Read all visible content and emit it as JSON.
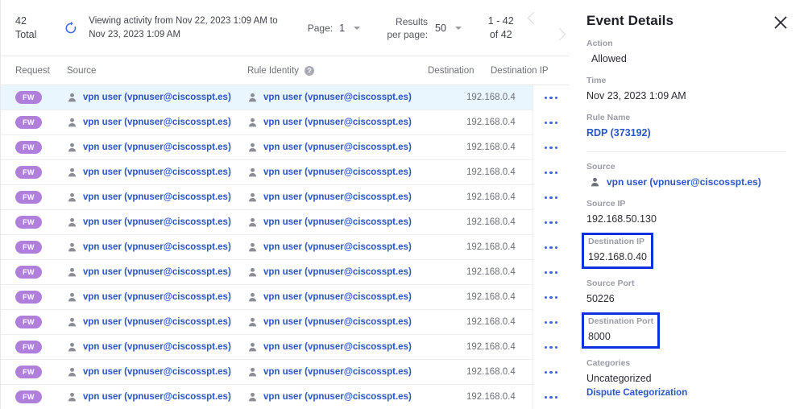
{
  "toolbar": {
    "total_count": "42",
    "total_label": "Total",
    "refresh_icon": "refresh-icon",
    "range_text": "Viewing activity from Nov 22, 2023 1:09 AM to Nov 23, 2023 1:09 AM",
    "page_label": "Page:",
    "page_value": "1",
    "results_per_page_label": "Results per page:",
    "results_per_page_value": "50",
    "count_range": "1 - 42",
    "count_of": "of 42",
    "prev_icon": "chevron-left-icon",
    "next_icon": "chevron-right-icon"
  },
  "table": {
    "headers": {
      "request": "Request",
      "source": "Source",
      "rule_identity": "Rule Identity",
      "rule_identity_help": "?",
      "destination": "Destination",
      "destination_ip": "Destination IP"
    },
    "row_template": {
      "request_badge": "FW",
      "source_user": "vpn user (vpnuser@ciscosspt.es)",
      "rule_identity_user": "vpn user (vpnuser@ciscosspt.es)",
      "destination_ip": "192.168.0.4",
      "kebab_icon": "more-options-icon",
      "user_icon": "person-icon"
    },
    "row_count": 13,
    "selected_row_index": 0
  },
  "details": {
    "title": "Event Details",
    "close_icon": "close-icon",
    "action_label": "Action",
    "action_value": "Allowed",
    "time_label": "Time",
    "time_value": "Nov 23, 2023 1:09 AM",
    "rule_name_label": "Rule Name",
    "rule_name_value": "RDP (373192)",
    "source_label": "Source",
    "source_value": "vpn user (vpnuser@ciscosspt.es)",
    "source_ip_label": "Source IP",
    "source_ip_value": "192.168.50.130",
    "destination_ip_label": "Destination IP",
    "destination_ip_value": "192.168.0.40",
    "source_port_label": "Source Port",
    "source_port_value": "50226",
    "destination_port_label": "Destination Port",
    "destination_port_value": "8000",
    "categories_label": "Categories",
    "categories_value": "Uncategorized",
    "dispute_link": "Dispute Categorization"
  },
  "colors": {
    "highlight_box": "#0f2fe0",
    "link": "#2b54c6",
    "badge": "#b07fdc",
    "selected_row": "#eaf6fd"
  }
}
